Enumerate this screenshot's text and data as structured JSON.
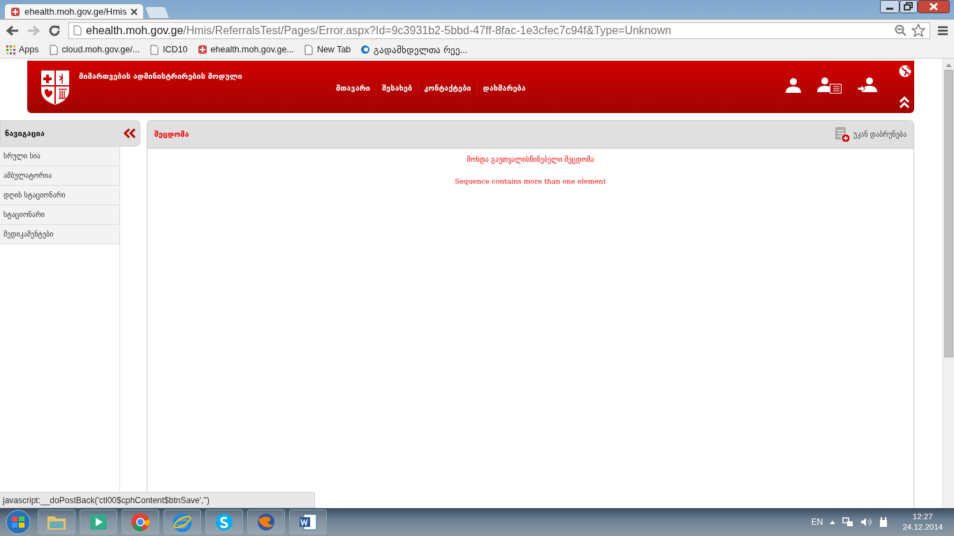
{
  "browser": {
    "tabs": [
      {
        "label": "ehealth.moh.gov.ge/Hmis",
        "selected": true
      }
    ],
    "url": {
      "host": "ehealth.moh.gov.ge",
      "path": "/Hmis/ReferralsTest/Pages/Error.aspx?Id=9c3931b2-5bbd-47ff-8fac-1e3cfec7c94f&Type=Unknown"
    },
    "bookmarks": [
      {
        "label": "Apps",
        "kind": "apps"
      },
      {
        "label": "cloud.moh.gov.ge/...",
        "kind": "page"
      },
      {
        "label": "ICD10",
        "kind": "page"
      },
      {
        "label": "ehealth.moh.gov.ge...",
        "kind": "crest"
      },
      {
        "label": "New Tab",
        "kind": "page"
      },
      {
        "label": "გადამხდელთა რეე...",
        "kind": "circle"
      }
    ],
    "status_text": "javascript:__doPostBack('ctl00$cphContent$btnSave','')"
  },
  "header": {
    "title": "მიმართვების ადმინისტრირების მოდული",
    "menu": [
      "მთავარი",
      "შესახებ",
      "კონტაქტები",
      "დახმარება"
    ]
  },
  "sidebar": {
    "title": "ნავიგაცია",
    "items": [
      "სრული სია",
      "ამბულატორია",
      "დღის სტაციონარი",
      "სტაციონარი",
      "მედიკამენტები"
    ]
  },
  "panel": {
    "title": "შეცდომა",
    "back_label": "უკან დაბრუნება",
    "messages": [
      "მოხდა გაუთვალისწინებელი შეცდომა",
      "Sequence contains more than one element"
    ]
  },
  "taskbar": {
    "language": "EN",
    "time": "12:27",
    "date": "24.12.2014"
  }
}
